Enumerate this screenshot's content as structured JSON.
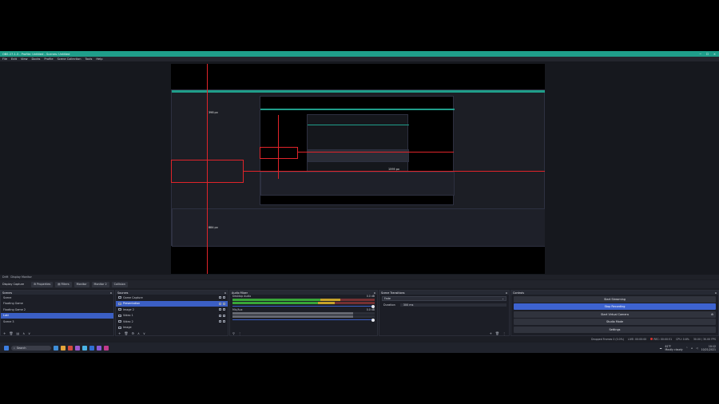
{
  "window": {
    "title": "OBS 27.1.3 - Profile: Untitled - Scenes: Untitled",
    "controls": [
      "minimize-icon",
      "maximize-icon",
      "close-icon"
    ]
  },
  "menu": [
    "File",
    "Edit",
    "View",
    "Docks",
    "Profile",
    "Scene Collection",
    "Tools",
    "Help"
  ],
  "preview": {
    "labels": {
      "height_a": "398 px",
      "width_a": "1595 px",
      "height_b": "884 px"
    }
  },
  "context_bar": {
    "source": "Drift",
    "label": "Display Monitor"
  },
  "toolbar": {
    "source_name": "Display Capture",
    "buttons": [
      "Properties",
      "Filters",
      "Monitor",
      "Monitor 2",
      "Collision"
    ]
  },
  "scenes": {
    "title": "Scenes",
    "items": [
      "Scene",
      "Floating Game",
      "Floating Game 2",
      "Loki",
      "Scene 3"
    ],
    "selected": 3
  },
  "sources": {
    "title": "Sources",
    "items": [
      "Game Capture",
      "Presentation",
      "Image 2",
      "Video 1",
      "Video 2",
      "Image"
    ],
    "selected": 1
  },
  "audio_mixer": {
    "title": "Audio Mixer",
    "channels": [
      {
        "name": "Desktop Audio",
        "db": "0.0 dB",
        "level": 0.68
      },
      {
        "name": "Mic/Aux",
        "db": "0.0 dB",
        "level": 0.57
      }
    ]
  },
  "transitions": {
    "title": "Scene Transitions",
    "transition": "Fade",
    "duration_label": "Duration",
    "duration_value": "300 ms"
  },
  "controls": {
    "title": "Controls",
    "buttons": [
      "Start Streaming",
      "Stop Recording",
      "Start Virtual Camera",
      "Studio Mode",
      "Settings"
    ],
    "active": 1
  },
  "status": {
    "dropped": "Dropped Frames 0 (0.0%)",
    "live": "LIVE: 00:00:00",
    "rec": "REC: 00:00:51",
    "cpu": "CPU: 0.6%",
    "fps": "30.00 / 30.00 FPS"
  },
  "taskbar": {
    "search": "Search",
    "weather_temp": "61°F",
    "weather_desc": "Mostly cloudy",
    "time": "10:12",
    "date": "10/21/2021",
    "icon_colors": [
      "#3f8ed8",
      "#e4a53a",
      "#d24b3c",
      "#9b59d0",
      "#4ab4e6",
      "#2f6fd2",
      "#8a5bd6",
      "#c23a8c"
    ]
  },
  "colors": {
    "accent": "#1f9e8a",
    "selection": "#3b5fc4",
    "redline": "#e0242a"
  }
}
